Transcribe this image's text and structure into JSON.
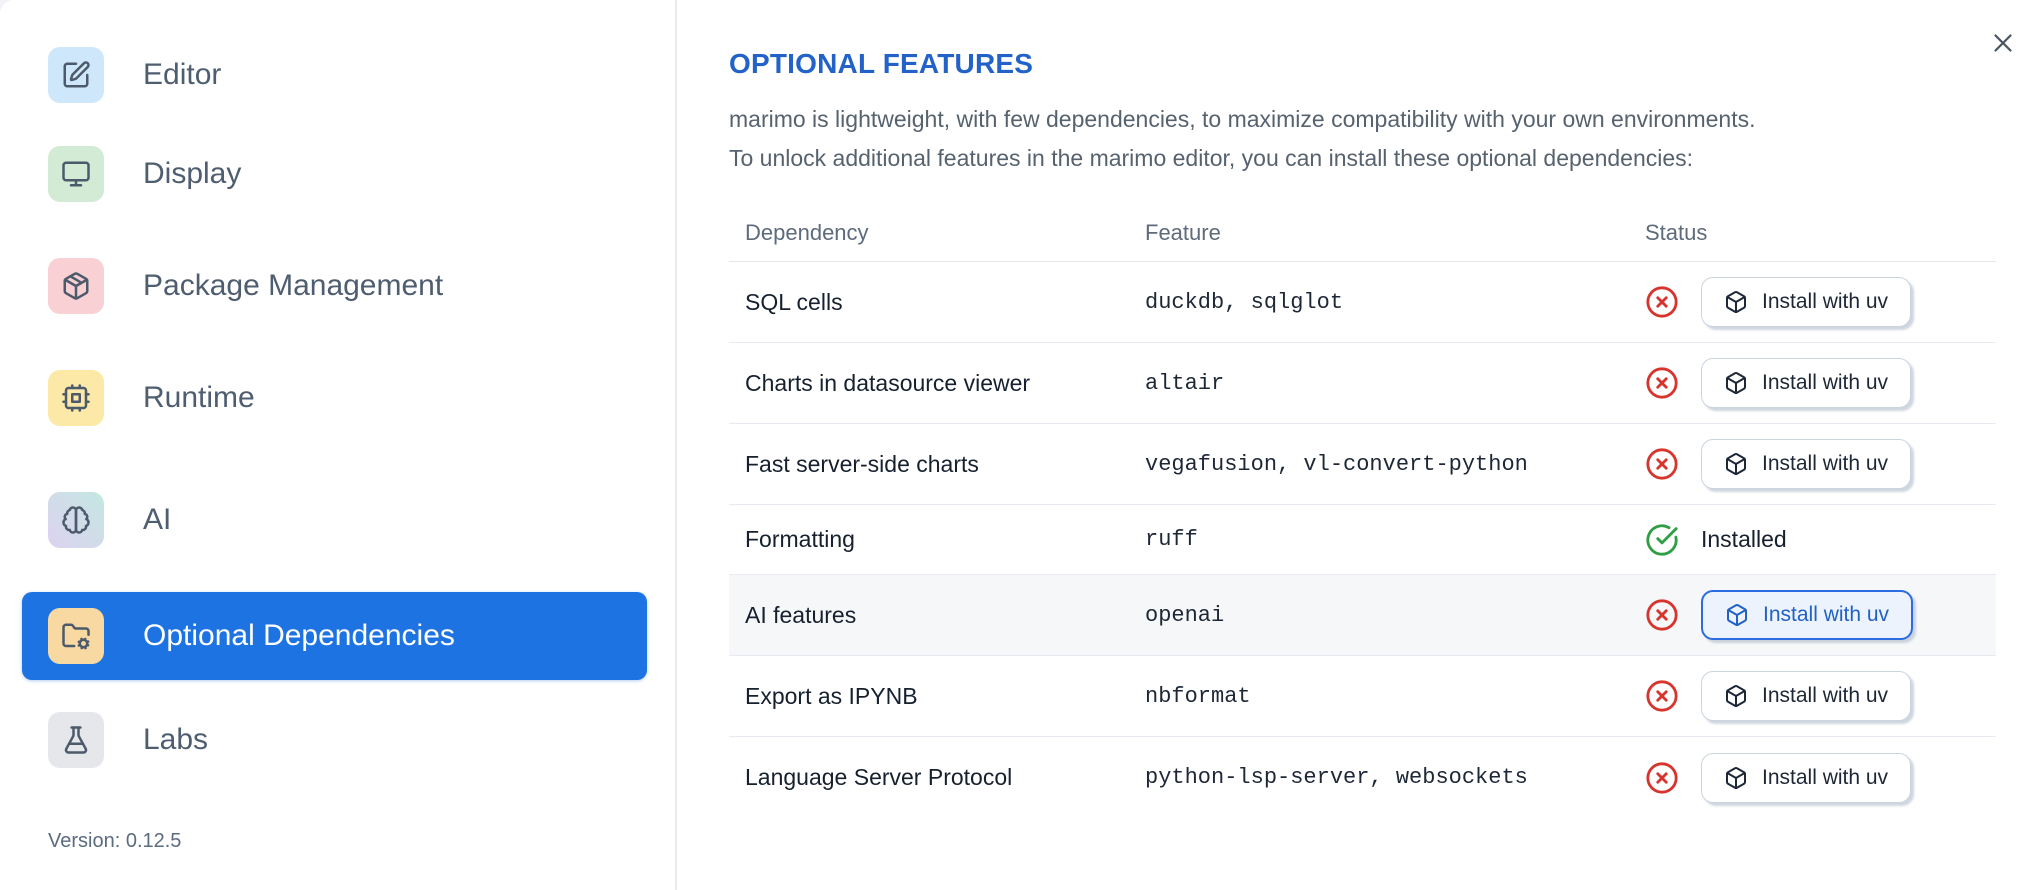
{
  "sidebar": {
    "items": [
      {
        "label": "Editor",
        "icon": "square-pen",
        "selected": false
      },
      {
        "label": "Display",
        "icon": "monitor",
        "selected": false
      },
      {
        "label": "Package Management",
        "icon": "package",
        "selected": false
      },
      {
        "label": "Runtime",
        "icon": "cpu",
        "selected": false
      },
      {
        "label": "AI",
        "icon": "brain",
        "selected": false
      },
      {
        "label": "Optional Dependencies",
        "icon": "folder-cog",
        "selected": true
      },
      {
        "label": "Labs",
        "icon": "flask-conical",
        "selected": false
      }
    ],
    "version": "Version: 0.12.5"
  },
  "panel": {
    "title": "OPTIONAL FEATURES",
    "description_lines": [
      "marimo is lightweight, with few dependencies, to maximize compatibility with your own environments.",
      "To unlock additional features in the marimo editor, you can install these optional dependencies:"
    ],
    "close_icon": "x-icon"
  },
  "table": {
    "columns": [
      "Dependency",
      "Feature",
      "Status"
    ],
    "install_button_label": "Install with uv",
    "installed_label": "Installed",
    "status_icons": {
      "missing": "circle-x-icon",
      "installed": "circle-check-icon"
    },
    "rows": [
      {
        "dependency": "SQL cells",
        "feature": "duckdb, sqlglot",
        "status": "missing",
        "highlighted": false
      },
      {
        "dependency": "Charts in datasource viewer",
        "feature": "altair",
        "status": "missing",
        "highlighted": false
      },
      {
        "dependency": "Fast server-side charts",
        "feature": "vegafusion, vl-convert-python",
        "status": "missing",
        "highlighted": false
      },
      {
        "dependency": "Formatting",
        "feature": "ruff",
        "status": "installed",
        "highlighted": false
      },
      {
        "dependency": "AI features",
        "feature": "openai",
        "status": "missing",
        "highlighted": true
      },
      {
        "dependency": "Export as IPYNB",
        "feature": "nbformat",
        "status": "missing",
        "highlighted": false
      },
      {
        "dependency": "Language Server Protocol",
        "feature": "python-lsp-server, websockets",
        "status": "missing",
        "highlighted": false
      }
    ]
  },
  "colors": {
    "selected_item_bg": "#1e73e3",
    "title_blue": "#2362c9",
    "status_missing_red": "#d7342e",
    "status_installed_green": "#2f9e44",
    "primary_button_border": "#2b6ce0",
    "primary_button_bg": "#ecf3fd",
    "row_highlight_bg": "#f6f7f9",
    "divider": "#e7eaf0",
    "tile_editor": "#cfe7fb",
    "tile_display": "#d3ebd4",
    "tile_package": "#f9d0d4",
    "tile_runtime": "#fce9a8",
    "tile_optional_dependencies": "#f8d9a2",
    "tile_labs": "#e6e7ea"
  }
}
